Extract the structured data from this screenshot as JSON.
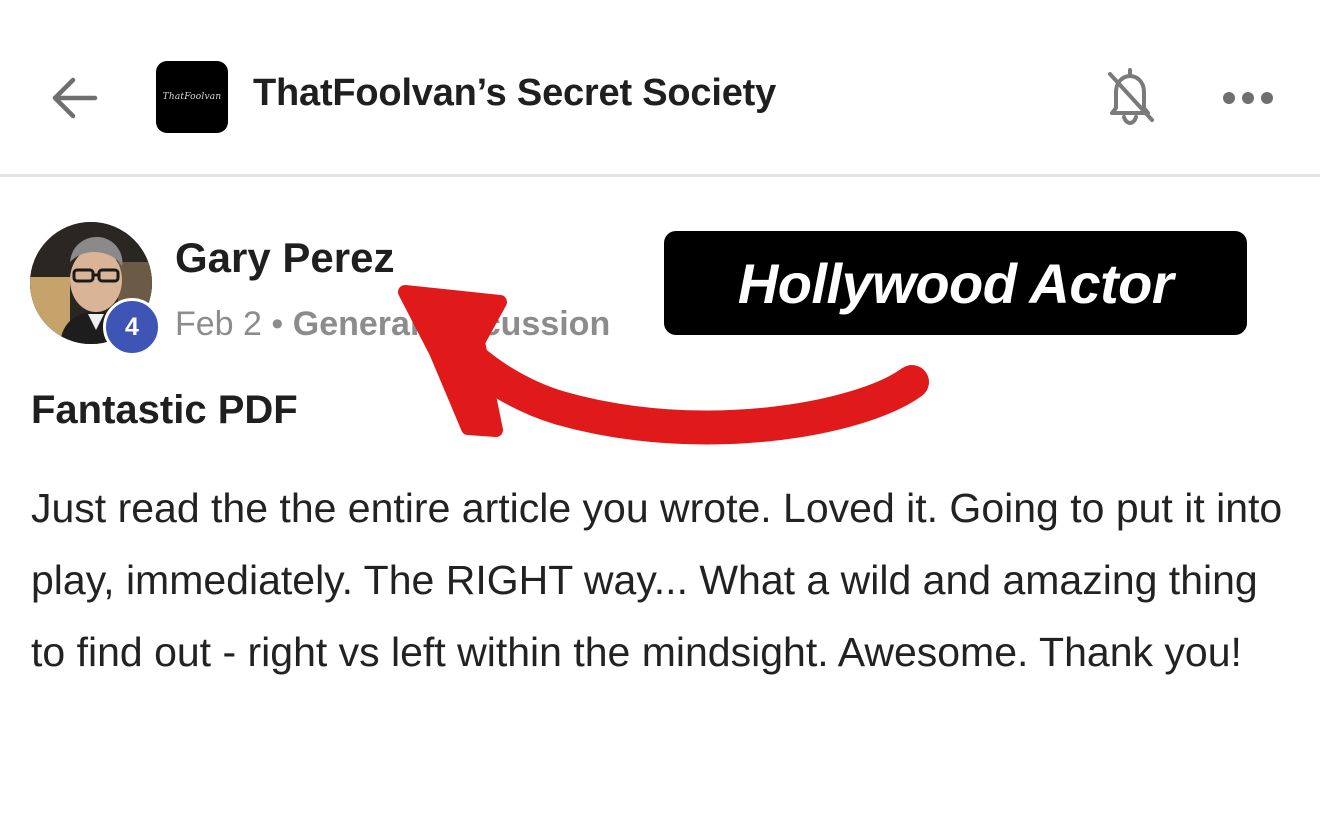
{
  "header": {
    "group_logo_text": "ThatFoolvan",
    "group_title": "ThatFoolvan’s Secret Society"
  },
  "post": {
    "author": "Gary Perez",
    "level": "4",
    "date": "Feb 2",
    "separator": "•",
    "category": "General Discussion",
    "title": "Fantastic PDF",
    "body": "Just read the the entire article you wrote. Loved it. Going to put it into play, immediately. The RIGHT way... What a wild and amazing thing to find out - right vs left within the mindsight. Awesome. Thank you!"
  },
  "annotation": {
    "label": "Hollywood Actor",
    "arrow_color": "#e01a1a"
  },
  "icons": {
    "back": "arrow-left-icon",
    "bell": "bell-off-icon",
    "more": "more-horizontal-icon"
  }
}
